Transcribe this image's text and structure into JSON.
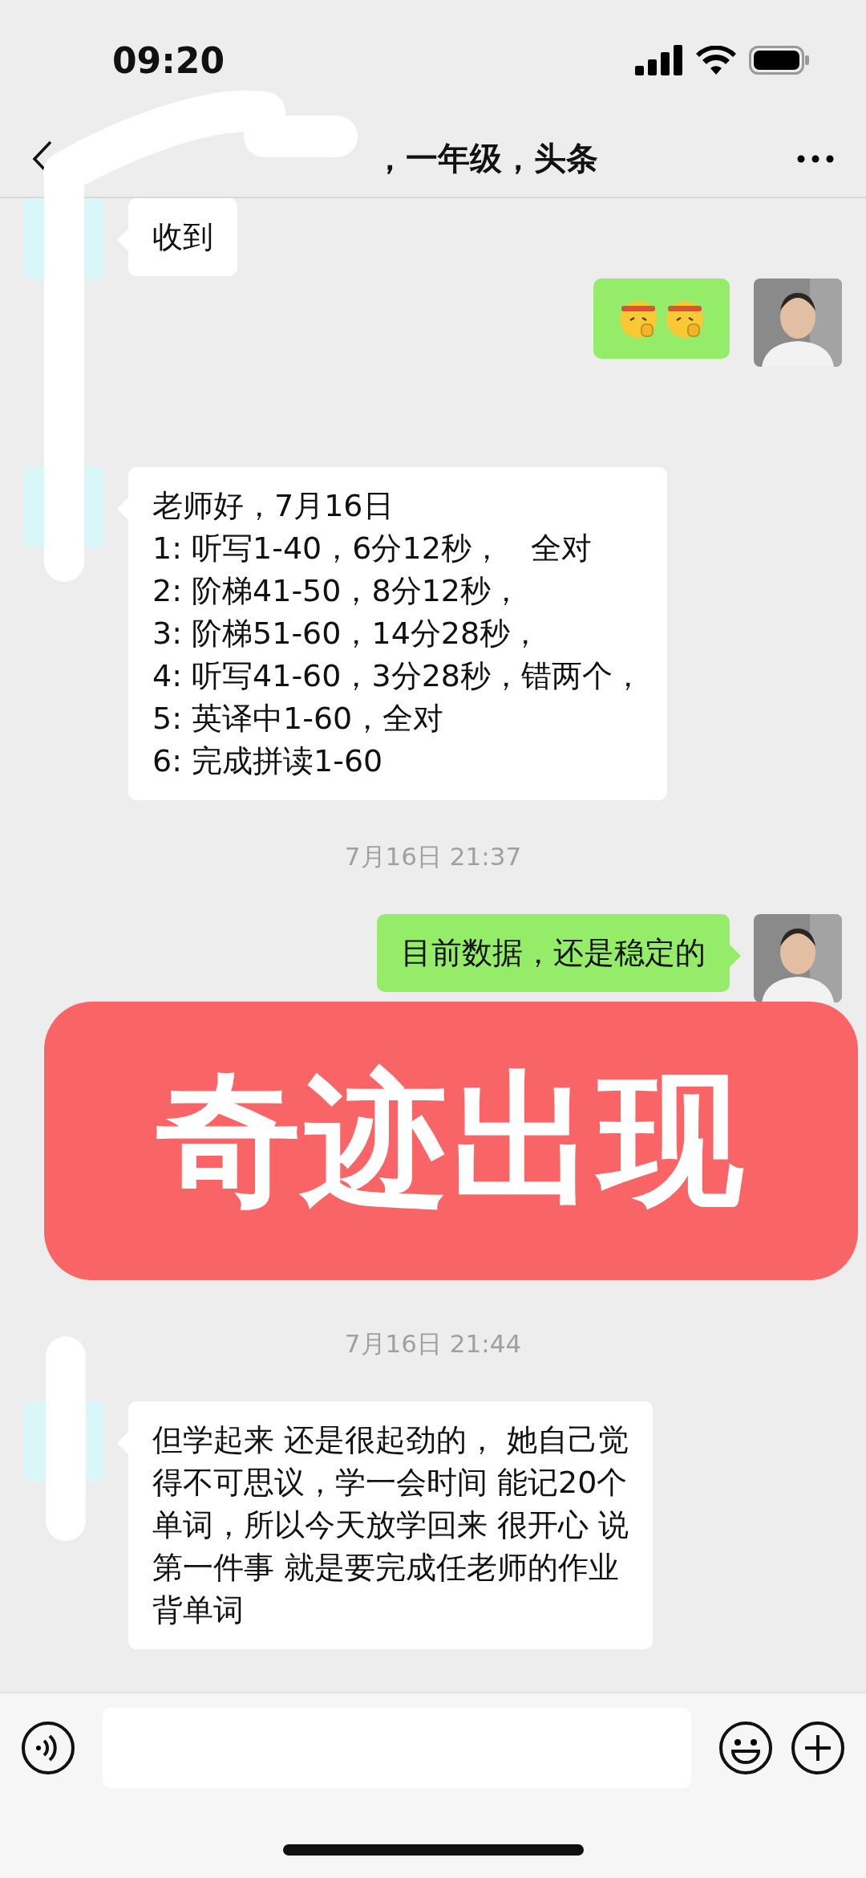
{
  "status_bar": {
    "time": "09:20"
  },
  "header": {
    "title": "，一年级，头条"
  },
  "messages": [
    {
      "kind": "incoming_text",
      "lines": [
        "收到"
      ]
    },
    {
      "kind": "outgoing_emoji"
    },
    {
      "kind": "incoming_text",
      "lines": [
        "老师好，7月16日",
        "1: 听写1-40，6分12秒，   全对",
        "2: 阶梯41-50，8分12秒，",
        "3: 阶梯51-60，14分28秒，",
        "4: 听写41-60，3分28秒，错两个，",
        "5: 英译中1-60，全对",
        "6: 完成拼读1-60"
      ]
    },
    {
      "kind": "time",
      "text": "7月16日 21:37"
    },
    {
      "kind": "outgoing_text",
      "lines": [
        "目前数据，还是稳定的"
      ]
    },
    {
      "kind": "hidden"
    },
    {
      "kind": "time",
      "text": "7月16日 21:44"
    },
    {
      "kind": "incoming_text",
      "lines": [
        "但学起来 还是很起劲的， 她自己觉",
        "得不可思议，学一会时间 能记20个",
        "单词，所以今天放学回来 很开心 说",
        "第一件事 就是要完成任老师的作业",
        "背单词"
      ]
    }
  ],
  "banner": {
    "text": "奇迹出现"
  }
}
